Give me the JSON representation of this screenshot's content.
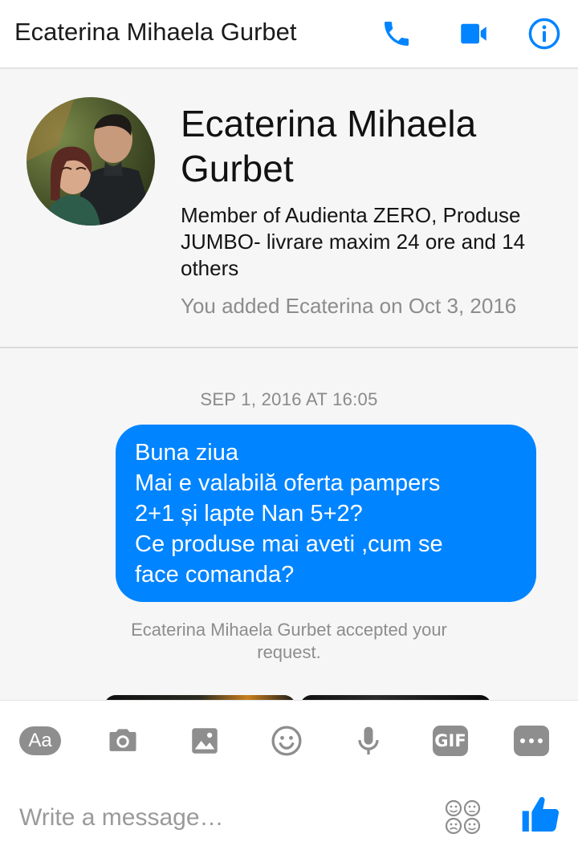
{
  "header": {
    "title": "Ecaterina Mihaela Gurbet",
    "icons": [
      "phone-icon",
      "video-camera-icon",
      "info-icon"
    ],
    "accent_color": "#0084ff"
  },
  "profile": {
    "name": "Ecaterina Mihaela Gurbet",
    "members": "Member of Audienta ZERO, Produse JUMBO- livrare maxim 24 ore and 14 others",
    "added": "You added Ecaterina on Oct 3, 2016"
  },
  "conversation": {
    "timestamp": "SEP 1, 2016 AT 16:05",
    "message": {
      "lines": [
        "Buna ziua",
        "Mai e valabilă oferta pampers",
        "2+1 și lapte Nan 5+2?",
        "Ce produse mai aveti ,cum se",
        "face comanda?"
      ],
      "bubble_color": "#0084ff"
    },
    "notice": "Ecaterina Mihaela Gurbet accepted your request."
  },
  "composer": {
    "toolbar": {
      "aa_label": "Aa",
      "gif_label": "GIF",
      "icons": [
        "text-format-icon",
        "camera-icon",
        "image-icon",
        "emoji-icon",
        "microphone-icon",
        "gif-icon",
        "more-icon"
      ],
      "icon_color": "#8e8e8e"
    },
    "placeholder": "Write a message…",
    "value": "",
    "like_color": "#0084ff"
  }
}
